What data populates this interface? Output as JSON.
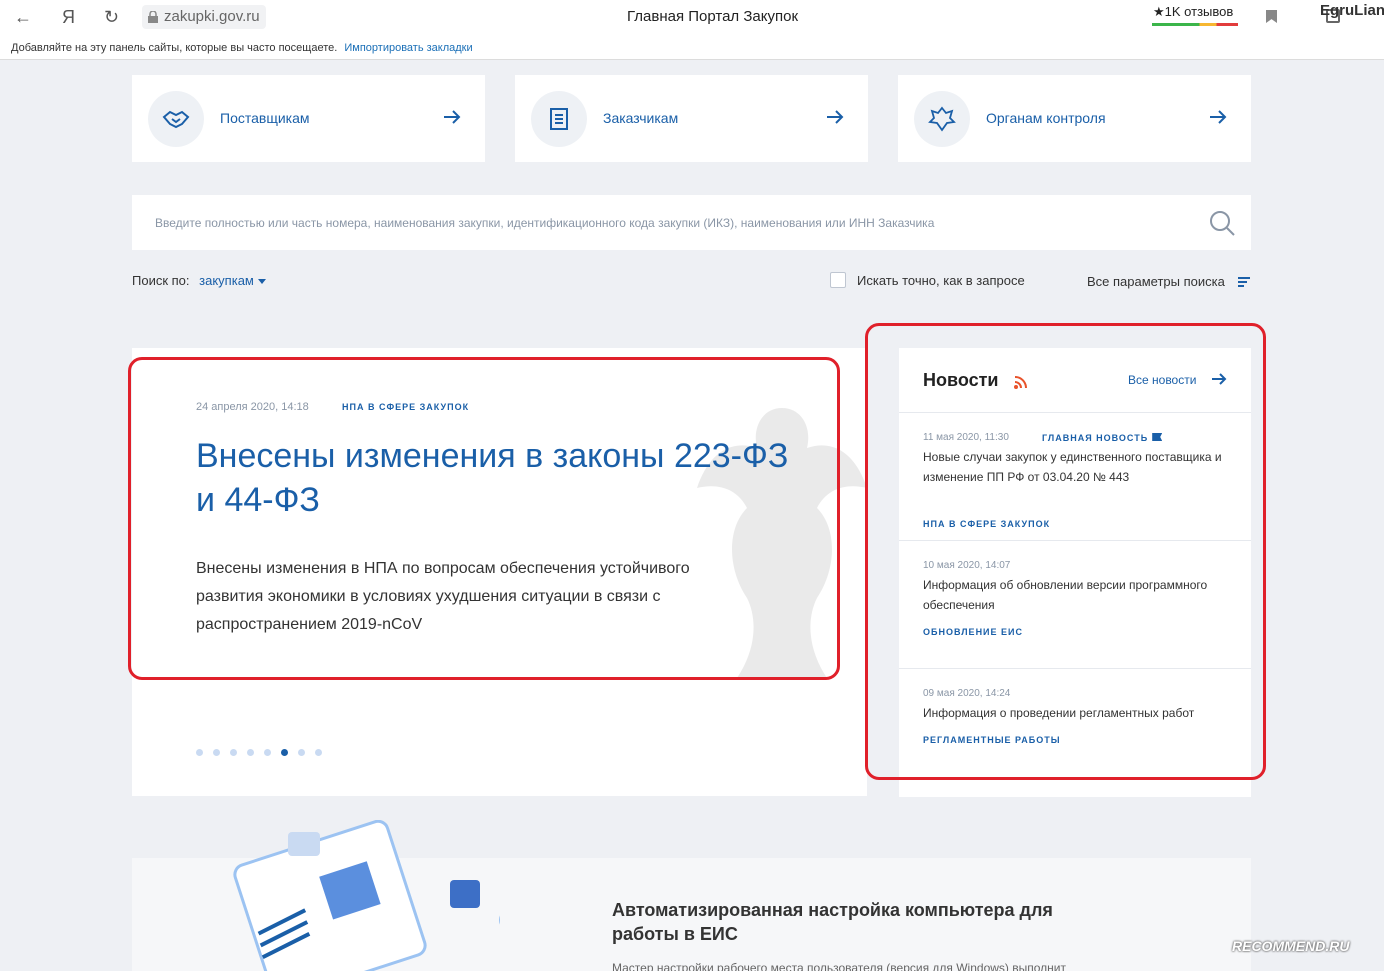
{
  "browser": {
    "url": "zakupki.gov.ru",
    "title": "Главная Портал Закупок",
    "reviews": "★1K отзывов",
    "user_watermark": "EgruLian",
    "bookmarks_hint": "Добавляйте на эту панель сайты, которые вы часто посещаете.",
    "import_link": "Импортировать закладки",
    "icons": [
      "back-arrow-icon",
      "yandex-icon",
      "reload-icon",
      "lock-icon",
      "bookmark-icon",
      "copy-icon"
    ]
  },
  "cards": [
    {
      "label": "Поставщикам",
      "icon": "handshake-icon"
    },
    {
      "label": "Заказчикам",
      "icon": "document-icon"
    },
    {
      "label": "Органам контроля",
      "icon": "emblem-icon"
    }
  ],
  "search": {
    "placeholder": "Введите полностью или часть номера, наименования закупки, идентификационного кода закупки (ИКЗ), наименования или ИНН Заказчика",
    "by_label": "Поиск по:",
    "by_value": "закупкам",
    "exact_label": "Искать точно, как в запросе",
    "all_params": "Все параметры поиска"
  },
  "featured": {
    "date": "24 апреля 2020, 14:18",
    "category": "НПА В СФЕРЕ ЗАКУПОК",
    "headline": "Внесены изменения в законы 223-ФЗ и 44-ФЗ",
    "lead": "Внесены изменения в НПА по вопросам обеспечения устойчивого развития экономики в условиях ухудшения ситуации в связи с распространением 2019-nCoV",
    "slides_total": 8,
    "slide_active": 6
  },
  "news": {
    "title": "Новости",
    "all_link": "Все новости",
    "items": [
      {
        "date": "11 мая 2020, 11:30",
        "flag": "ГЛАВНАЯ НОВОСТЬ",
        "text": "Новые случаи закупок у единственного поставщика и изменение ПП РФ от 03.04.20 № 443",
        "tag": "НПА В СФЕРЕ ЗАКУПОК"
      },
      {
        "date": "10 мая 2020, 14:07",
        "text": "Информация об обновлении версии программного обеспечения",
        "tag": "ОБНОВЛЕНИЕ ЕИС"
      },
      {
        "date": "09 мая 2020, 14:24",
        "text": "Информация о проведении регламентных работ",
        "tag": "РЕГЛАМЕНТНЫЕ РАБОТЫ"
      }
    ]
  },
  "banner": {
    "title": "Автоматизированная настройка компьютера для работы в ЕИС",
    "subtitle": "Мастер настройки рабочего места пользователя (версия для Windows) выполнит"
  },
  "watermark": "RECOMMEND.RU",
  "colors": {
    "accent": "#1a5fa8",
    "highlight": "#e0202a",
    "rss": "#e8532b"
  }
}
